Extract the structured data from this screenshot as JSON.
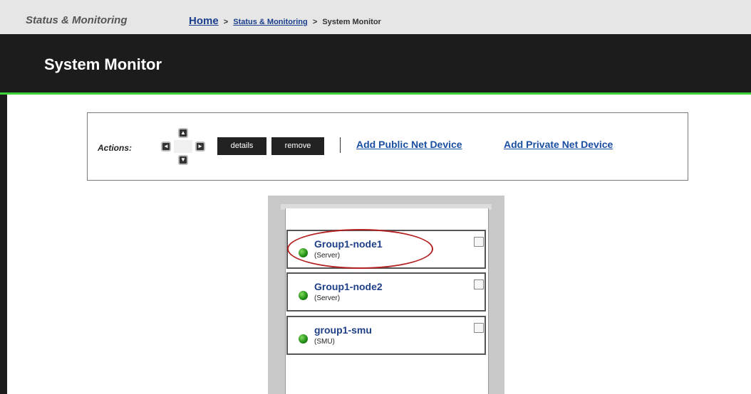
{
  "topbar": {
    "section_title": "Status & Monitoring",
    "breadcrumb": {
      "home": "Home",
      "separator": ">",
      "parent": "Status & Monitoring",
      "current": "System Monitor"
    }
  },
  "header": {
    "title": "System Monitor"
  },
  "actions": {
    "label": "Actions:",
    "dpad": {
      "up": "▲",
      "left": "◄",
      "right": "►",
      "down": "▼"
    },
    "details_button": "details",
    "remove_button": "remove",
    "add_public_link": "Add Public Net Device",
    "add_private_link": "Add Private Net Device"
  },
  "devices": [
    {
      "name": "Group1-node1",
      "type": "(Server)",
      "status_color": "#2e9e1f",
      "checked": false
    },
    {
      "name": "Group1-node2",
      "type": "(Server)",
      "status_color": "#2e9e1f",
      "checked": false
    },
    {
      "name": "group1-smu",
      "type": "(SMU)",
      "status_color": "#2e9e1f",
      "checked": false
    }
  ],
  "colors": {
    "header_bg": "#1c1c1c",
    "accent_green": "#3cd23c",
    "link_blue": "#1a4ea0",
    "highlight_red": "#b22222"
  }
}
